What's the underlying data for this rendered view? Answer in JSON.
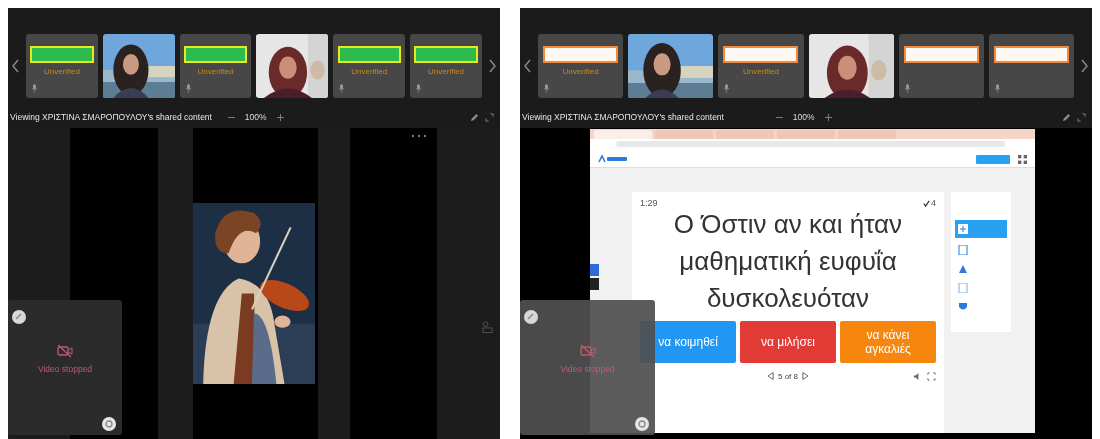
{
  "panels": [
    {
      "participants": [
        {
          "kind": "avatar",
          "label": "Unverified",
          "redaction": {
            "color": "#e6ea1c",
            "inner": {
              "color": "#2dbb4e"
            }
          }
        },
        {
          "kind": "camera"
        },
        {
          "kind": "avatar",
          "label": "Unverified",
          "redaction": {
            "color": "#e6ea1c",
            "inner": {
              "color": "#2dbb4e"
            }
          }
        },
        {
          "kind": "camera"
        },
        {
          "kind": "avatar",
          "label": "Unverified",
          "redaction": {
            "color": "#e6ea1c",
            "inner": {
              "color": "#2dbb4e"
            }
          }
        },
        {
          "kind": "avatar",
          "label": "Unverified",
          "redaction": {
            "color": "#e6ea1c",
            "inner": {
              "color": "#2dbb4e"
            }
          }
        }
      ],
      "viewing_text": "Viewing ΧΡΙΣΤΙΝΑ ΣΜΑΡΟΠΟΥΛΟΥ's shared content",
      "zoom": "100%",
      "self_view": {
        "status": "Video stopped"
      }
    },
    {
      "participants": [
        {
          "kind": "avatar",
          "label": "Unverified",
          "redaction": {
            "color": "#f28a3c",
            "inner": {
              "color": "#fff8f2"
            }
          }
        },
        {
          "kind": "camera"
        },
        {
          "kind": "avatar",
          "label": "Unverified",
          "redaction": {
            "color": "#f28a3c",
            "inner": {
              "color": "#fff8f2"
            }
          }
        },
        {
          "kind": "camera"
        },
        {
          "kind": "avatar",
          "redaction": {
            "color": "#f28a3c",
            "inner": {
              "color": "#fff8f2"
            }
          }
        },
        {
          "kind": "avatar",
          "redaction": {
            "color": "#f28a3c",
            "inner": {
              "color": "#fff8f2"
            }
          }
        }
      ],
      "viewing_text": "Viewing ΧΡΙΣΤΙΝΑ ΣΜΑΡΟΠΟΥΛΟΥ's shared content",
      "zoom": "100%",
      "shared": {
        "kind": "browser",
        "tabs": [
          {
            "selected": true
          },
          {
            "selected": false
          },
          {
            "selected": false
          },
          {
            "selected": false
          },
          {
            "selected": false
          }
        ],
        "timer": "1:29",
        "score": "4",
        "question": "Ο Όστιν αν και ήταν μαθηματική ευφυΐα δυσκολευόταν",
        "answers": [
          {
            "text": "να κοιμηθεί",
            "color": "#2196f3"
          },
          {
            "text": "να μιλήσει",
            "color": "#e23a35"
          },
          {
            "text": "να κάνει αγκαλιές",
            "color": "#f7860f"
          }
        ],
        "pager": "5 of 8"
      },
      "self_view": {
        "status": "Video stopped"
      }
    }
  ]
}
